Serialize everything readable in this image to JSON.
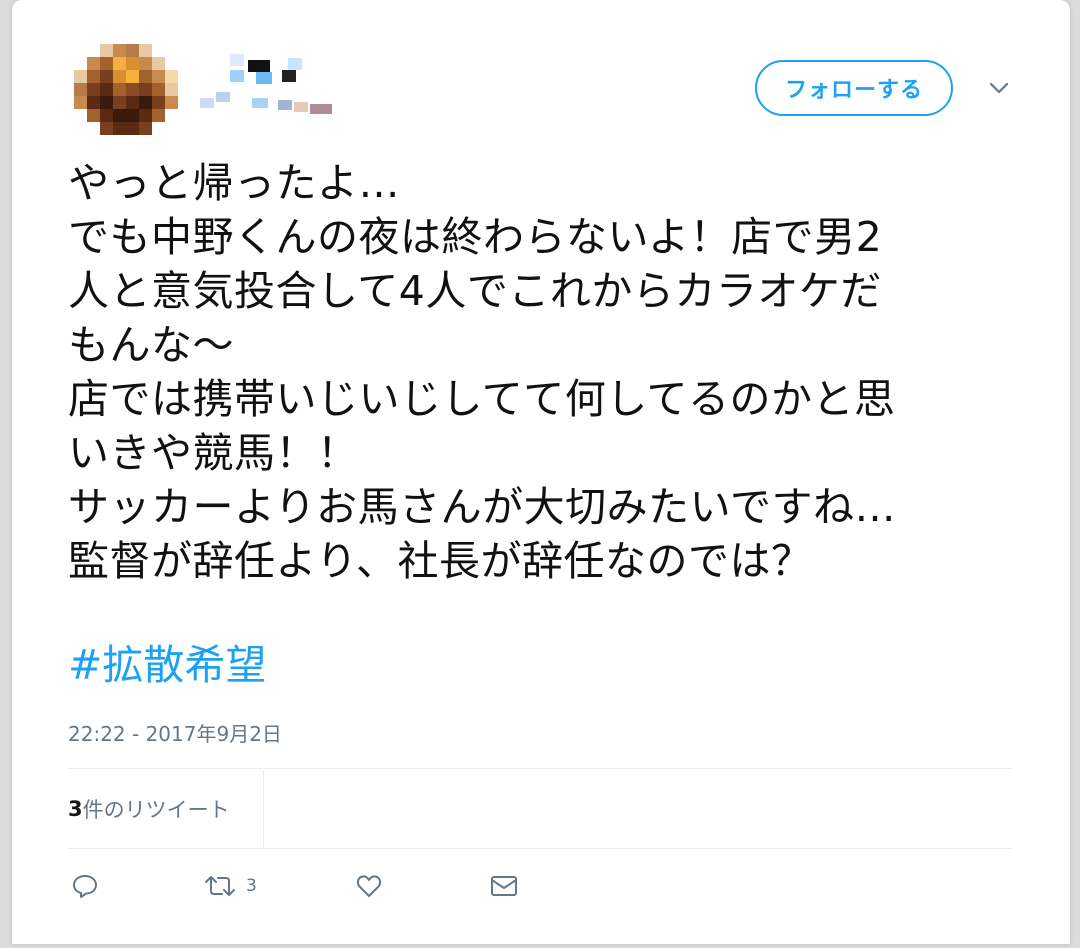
{
  "header": {
    "follow_label": "フォローする"
  },
  "tweet": {
    "lines": [
      "やっと帰ったよ…",
      "でも中野くんの夜は終わらないよ！店で男2",
      "人と意気投合して4人でこれからカラオケだ",
      "もんな〜",
      "店では携帯いじいじしてて何してるのかと思",
      "いきや競馬！！",
      "サッカーよりお馬さんが大切みたいですね…",
      "監督が辞任より、社長が辞任なのでは？"
    ],
    "hashtag": "#拡散希望",
    "timestamp": "22:22 - 2017年9月2日"
  },
  "stats": {
    "retweet_count": "3",
    "retweet_suffix": "件のリツイート"
  },
  "actions": {
    "reply_icon": "reply-icon",
    "retweet_icon": "retweet-icon",
    "retweet_count": "3",
    "like_icon": "heart-icon",
    "dm_icon": "envelope-icon"
  },
  "colors": {
    "accent": "#1da1f2",
    "muted": "#657786",
    "text": "#111111",
    "divider": "#e6ecf0"
  }
}
